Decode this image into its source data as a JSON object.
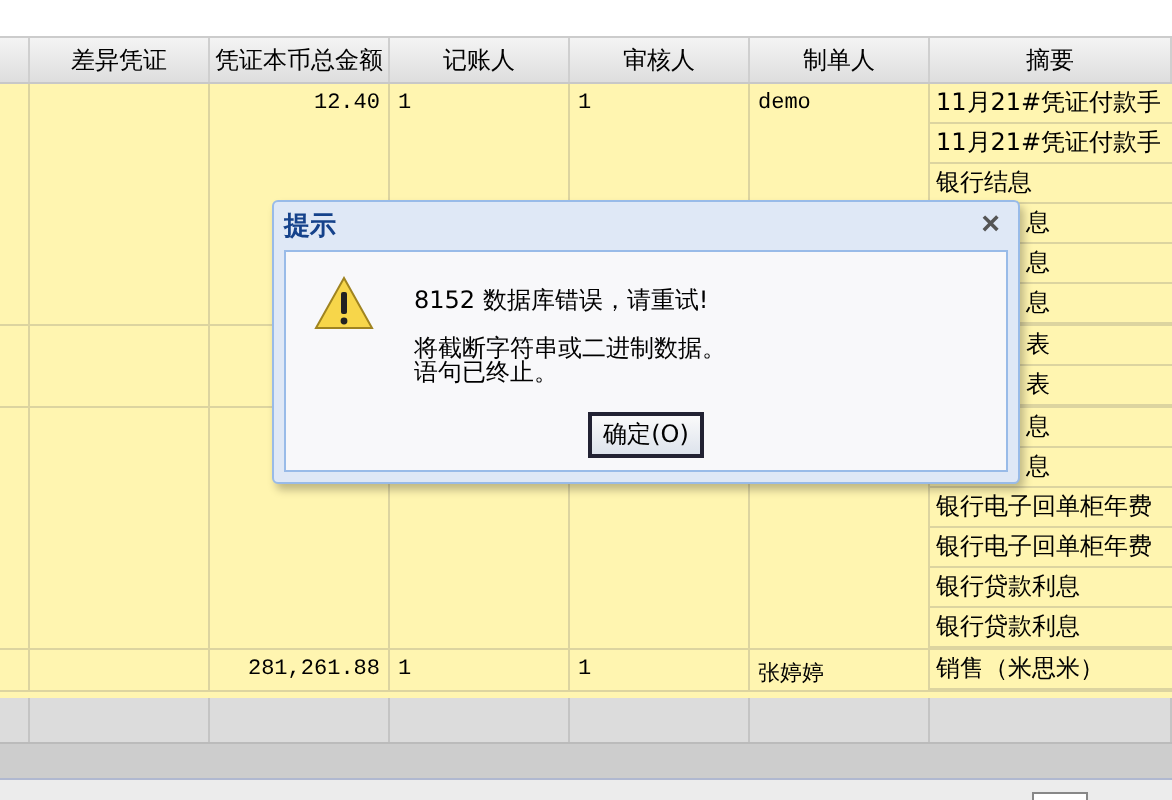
{
  "table": {
    "columns": [
      "",
      "差异凭证",
      "凭证本币总金额",
      "记账人",
      "审核人",
      "制单人",
      "摘要"
    ],
    "groups": [
      {
        "amount": "12.40",
        "bookkeeper": "1",
        "reviewer": "1",
        "maker": "demo",
        "summaries": [
          {
            "text": "11月21#凭证付款手",
            "kind": "full"
          },
          {
            "text": "11月21#凭证付款手",
            "kind": "full"
          },
          {
            "text": "银行结息",
            "kind": "full"
          },
          {
            "text": "息",
            "kind": "partial"
          },
          {
            "text": "息",
            "kind": "partial"
          },
          {
            "text": "息",
            "kind": "partial"
          }
        ]
      },
      {
        "summaries": [
          {
            "text": "表",
            "kind": "partial"
          },
          {
            "text": "表",
            "kind": "partial"
          }
        ]
      },
      {
        "summaries": [
          {
            "text": "息",
            "kind": "partial"
          },
          {
            "text": "息",
            "kind": "partial"
          },
          {
            "text": "银行电子回单柜年费",
            "kind": "full"
          },
          {
            "text": "银行电子回单柜年费",
            "kind": "full"
          },
          {
            "text": "银行贷款利息",
            "kind": "full"
          },
          {
            "text": "银行贷款利息",
            "kind": "full"
          }
        ]
      },
      {
        "amount": "281,261.88",
        "bookkeeper": "1",
        "reviewer": "1",
        "maker": "张婷婷",
        "summaries": [
          {
            "text": "销售（米思米）",
            "kind": "full"
          }
        ]
      }
    ]
  },
  "dialog": {
    "title": "提示",
    "close": "×",
    "message": "8152 数据库错误，请重试!",
    "details": [
      "将截断字符串或二进制数据。",
      "语句已终止。"
    ],
    "button": "确定(O)"
  }
}
